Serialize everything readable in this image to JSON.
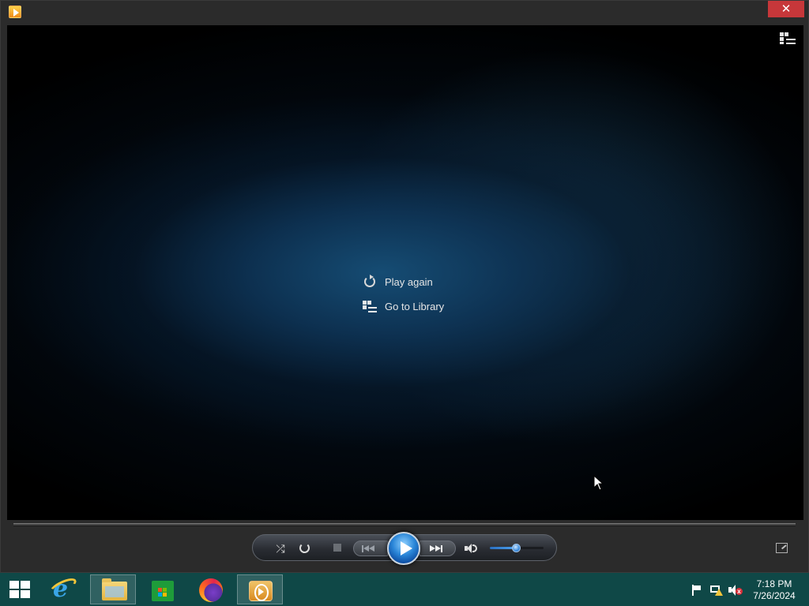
{
  "window": {
    "app_icon": "windows-media-player-icon",
    "close_symbol": "✕"
  },
  "player": {
    "switch_to_library_icon": "switch-to-library-icon",
    "center_menu": [
      {
        "label": "Play again",
        "icon": "replay-icon"
      },
      {
        "label": "Go to Library",
        "icon": "library-icon"
      }
    ],
    "seek_progress": 0,
    "controls": {
      "shuffle_icon": "⤮",
      "repeat_icon": "repeat-icon",
      "stop_icon": "stop-icon",
      "previous_icon": "previous-icon",
      "play_icon": "play-icon",
      "next_icon": "next-icon",
      "mute_icon": "speaker-icon",
      "volume_level": 0.5,
      "fullscreen_icon": "view-full-screen-icon"
    }
  },
  "taskbar": {
    "items": [
      {
        "name": "start",
        "icon": "windows-logo-icon"
      },
      {
        "name": "internet-explorer",
        "icon": "internet-explorer-icon"
      },
      {
        "name": "file-explorer",
        "icon": "folder-icon",
        "active": true
      },
      {
        "name": "store",
        "icon": "store-icon"
      },
      {
        "name": "firefox",
        "icon": "firefox-icon"
      },
      {
        "name": "windows-media-player",
        "icon": "media-player-icon",
        "active": true
      }
    ],
    "tray": {
      "icons": [
        "action-center-flag-icon",
        "network-warning-icon",
        "speaker-muted-icon"
      ],
      "time": "7:18 PM",
      "date": "7/26/2024"
    }
  },
  "colors": {
    "taskbar": "#0f4847",
    "close_button": "#c7373a",
    "play_button": "#2a86d8",
    "window_frame": "#2b2b2b"
  }
}
